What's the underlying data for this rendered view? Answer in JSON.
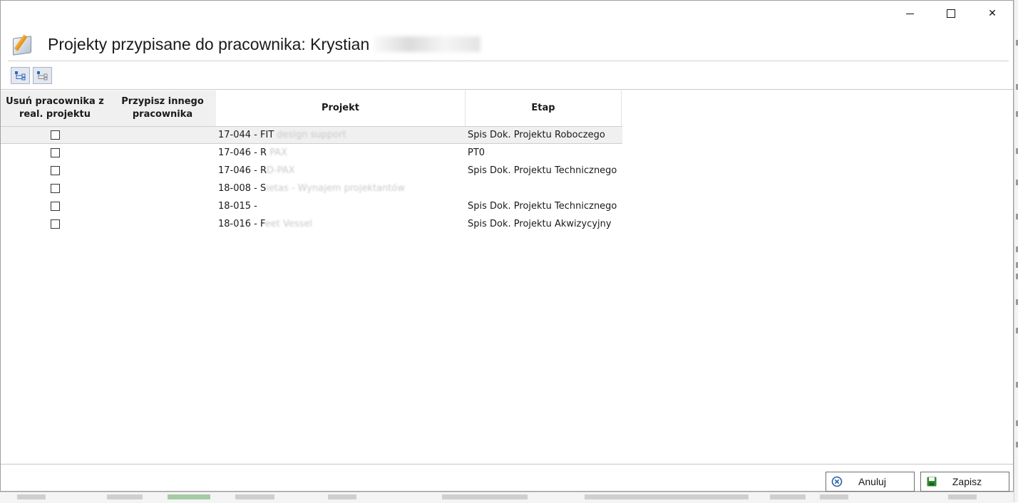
{
  "window": {
    "title": "Projekty przypisane do pracownika: Krystian",
    "controls": {
      "minimize": "minimize",
      "maximize": "maximize",
      "close": "✕"
    }
  },
  "toolbar": {
    "buttons": [
      {
        "icon": "expand-tree-icon"
      },
      {
        "icon": "collapse-tree-icon"
      }
    ]
  },
  "grid": {
    "columns": {
      "remove": "Usuń pracownika z real. projektu",
      "assign": "Przypisz innego pracownika",
      "project": "Projekt",
      "stage": "Etap"
    },
    "rows": [
      {
        "project_code": "17-044 - FIT",
        "project_rest": "design support",
        "stage": "Spis Dok. Projektu Roboczego",
        "remove_checked": false,
        "selected": true
      },
      {
        "project_code": "17-046 - R",
        "project_rest": "PAX",
        "stage": "PT0",
        "remove_checked": false,
        "selected": false
      },
      {
        "project_code": "17-046 - R",
        "project_rest": "D-PAX",
        "stage": "Spis Dok. Projektu Technicznego",
        "remove_checked": false,
        "selected": false
      },
      {
        "project_code": "18-008 - S",
        "project_rest": "ietas - Wynajem projektantów",
        "stage": "",
        "remove_checked": false,
        "selected": false
      },
      {
        "project_code": "18-015 -",
        "project_rest": "",
        "stage": "Spis Dok. Projektu Technicznego",
        "remove_checked": false,
        "selected": false
      },
      {
        "project_code": "18-016 - F",
        "project_rest": "eet Vessel",
        "stage": "Spis Dok. Projektu Akwizycyjny",
        "remove_checked": false,
        "selected": false
      }
    ]
  },
  "footer": {
    "cancel_label": "Anuluj",
    "save_label": "Zapisz"
  },
  "colors": {
    "cancel_icon": "#2b5fa8",
    "save_icon": "#2e8b2e",
    "toolbar_icon": "#2f66c0"
  }
}
